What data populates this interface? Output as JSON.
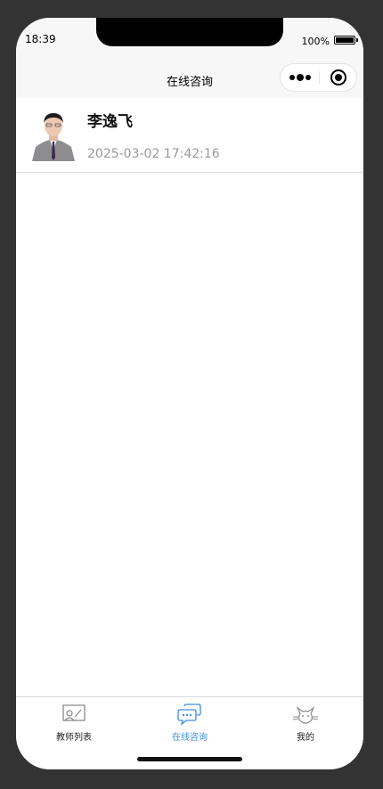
{
  "status": {
    "time": "18:39",
    "battery": "100%"
  },
  "nav": {
    "title": "在线咨询",
    "more_icon": "more-dots-icon",
    "close_icon": "target-circle-icon"
  },
  "conversations": [
    {
      "name": "李逸飞",
      "time": "2025-03-02 17:42:16",
      "avatar_icon": "person-photo-icon"
    }
  ],
  "tabs": [
    {
      "label": "教师列表",
      "icon": "teacher-board-icon",
      "active": false
    },
    {
      "label": "在线咨询",
      "icon": "chat-bubbles-icon",
      "active": true
    },
    {
      "label": "我的",
      "icon": "cat-face-icon",
      "active": false
    }
  ],
  "colors": {
    "accent": "#3d8de0",
    "background": "#333333",
    "nav_bg": "#f7f7f7",
    "muted_text": "#999999"
  }
}
